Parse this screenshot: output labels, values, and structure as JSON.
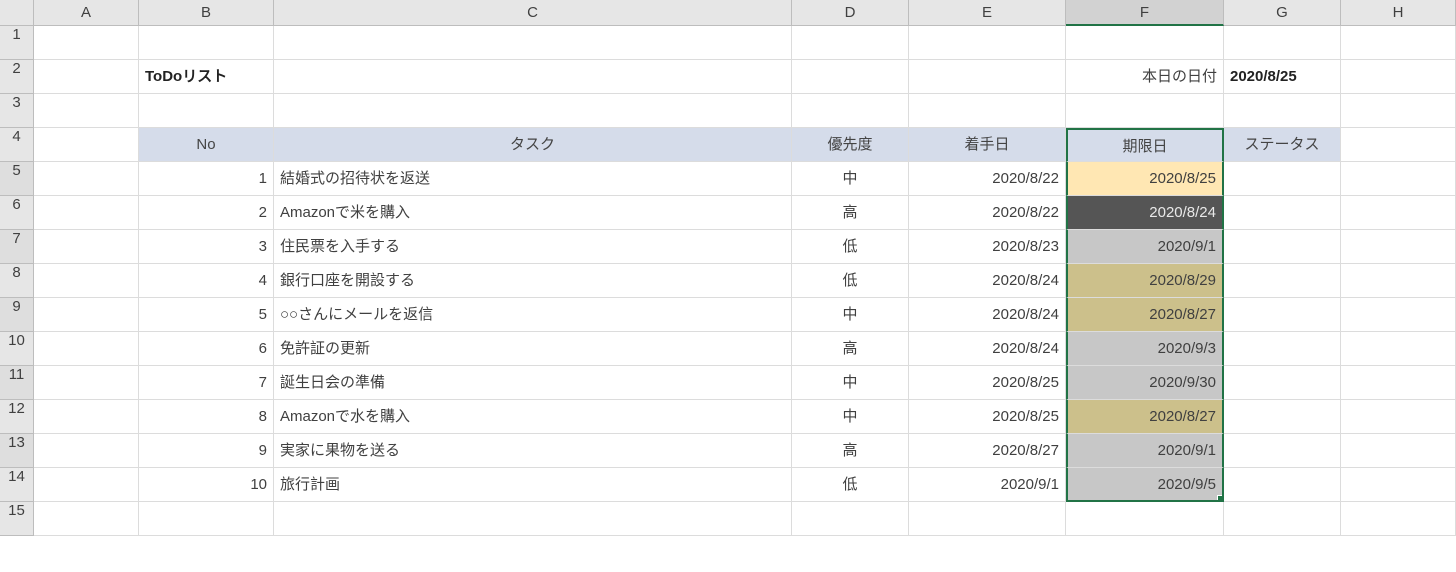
{
  "columns": [
    "",
    "A",
    "B",
    "C",
    "D",
    "E",
    "F",
    "G",
    "H"
  ],
  "row_numbers": [
    "1",
    "2",
    "3",
    "4",
    "5",
    "6",
    "7",
    "8",
    "9",
    "10",
    "11",
    "12",
    "13",
    "14",
    "15"
  ],
  "title": "ToDoリスト",
  "today_label": "本日の日付",
  "today_value": "2020/8/25",
  "headers": {
    "no": "No",
    "task": "タスク",
    "priority": "優先度",
    "start": "着手日",
    "due": "期限日",
    "status": "ステータス"
  },
  "chart_data": {
    "type": "table",
    "title": "ToDoリスト",
    "columns": [
      "No",
      "タスク",
      "優先度",
      "着手日",
      "期限日",
      "ステータス"
    ],
    "rows": [
      {
        "no": 1,
        "task": "結婚式の招待状を返送",
        "priority": "中",
        "start": "2020/8/22",
        "due": "2020/8/25",
        "due_bg": "yellow"
      },
      {
        "no": 2,
        "task": "Amazonで米を購入",
        "priority": "高",
        "start": "2020/8/22",
        "due": "2020/8/24",
        "due_bg": "dark"
      },
      {
        "no": 3,
        "task": "住民票を入手する",
        "priority": "低",
        "start": "2020/8/23",
        "due": "2020/9/1",
        "due_bg": "gray"
      },
      {
        "no": 4,
        "task": "銀行口座を開設する",
        "priority": "低",
        "start": "2020/8/24",
        "due": "2020/8/29",
        "due_bg": "olive"
      },
      {
        "no": 5,
        "task": "○○さんにメールを返信",
        "priority": "中",
        "start": "2020/8/24",
        "due": "2020/8/27",
        "due_bg": "olive"
      },
      {
        "no": 6,
        "task": "免許証の更新",
        "priority": "高",
        "start": "2020/8/24",
        "due": "2020/9/3",
        "due_bg": "gray"
      },
      {
        "no": 7,
        "task": "誕生日会の準備",
        "priority": "中",
        "start": "2020/8/25",
        "due": "2020/9/30",
        "due_bg": "gray"
      },
      {
        "no": 8,
        "task": "Amazonで水を購入",
        "priority": "中",
        "start": "2020/8/25",
        "due": "2020/8/27",
        "due_bg": "olive"
      },
      {
        "no": 9,
        "task": "実家に果物を送る",
        "priority": "高",
        "start": "2020/8/27",
        "due": "2020/9/1",
        "due_bg": "gray"
      },
      {
        "no": 10,
        "task": "旅行計画",
        "priority": "低",
        "start": "2020/9/1",
        "due": "2020/9/5",
        "due_bg": "gray"
      }
    ]
  }
}
